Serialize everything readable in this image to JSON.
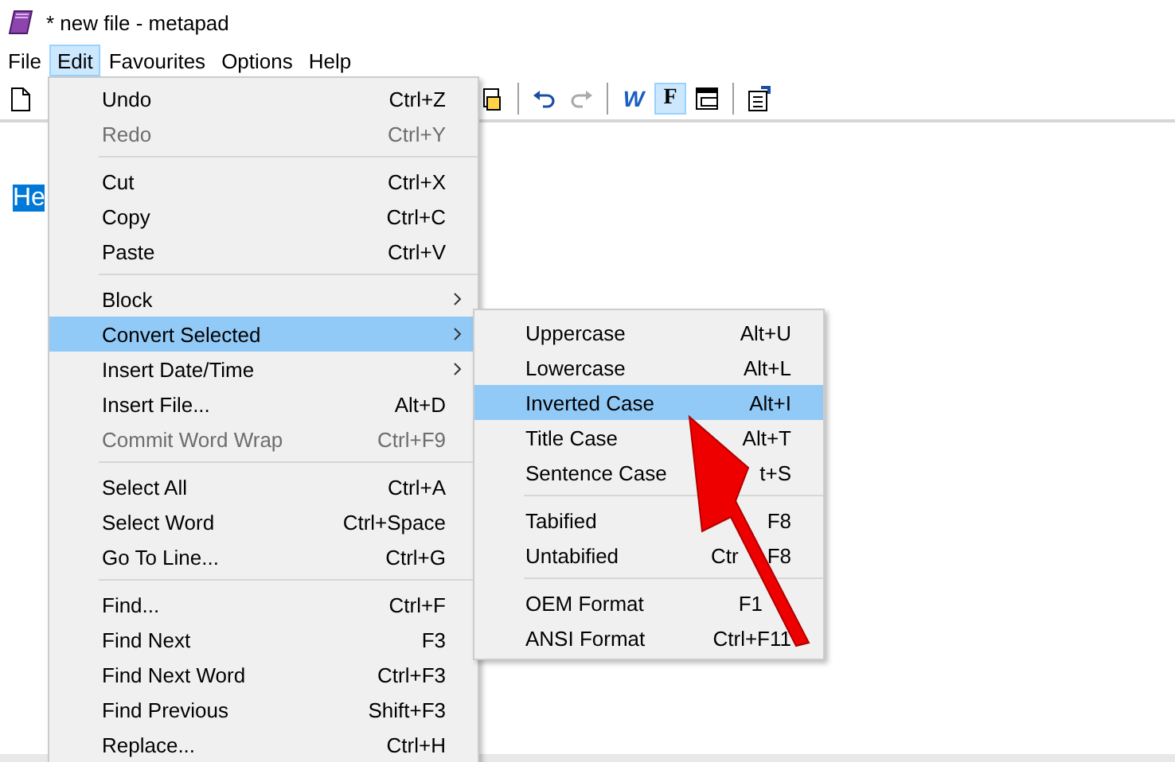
{
  "window": {
    "title": "* new file - metapad"
  },
  "menubar": [
    {
      "label": "File",
      "selected": false
    },
    {
      "label": "Edit",
      "selected": true
    },
    {
      "label": "Favourites",
      "selected": false
    },
    {
      "label": "Options",
      "selected": false
    },
    {
      "label": "Help",
      "selected": false
    }
  ],
  "toolbar": [
    {
      "kind": "new-file"
    },
    {
      "kind": "hidden"
    },
    {
      "kind": "print"
    },
    {
      "kind": "separator"
    },
    {
      "kind": "undo",
      "disabled": false
    },
    {
      "kind": "redo",
      "disabled": true
    },
    {
      "kind": "separator"
    },
    {
      "kind": "letter",
      "label": "W",
      "pressed": false
    },
    {
      "kind": "letter",
      "label": "F",
      "pressed": true
    },
    {
      "kind": "window",
      "pressed": false
    },
    {
      "kind": "separator"
    },
    {
      "kind": "properties"
    }
  ],
  "editor": {
    "selected_text": "He"
  },
  "edit_menu": [
    {
      "kind": "item",
      "label": "Undo",
      "shortcut": "Ctrl+Z",
      "disabled": false,
      "selected": false
    },
    {
      "kind": "item",
      "label": "Redo",
      "shortcut": "Ctrl+Y",
      "disabled": true,
      "selected": false
    },
    {
      "kind": "separator"
    },
    {
      "kind": "item",
      "label": "Cut",
      "shortcut": "Ctrl+X",
      "disabled": false,
      "selected": false
    },
    {
      "kind": "item",
      "label": "Copy",
      "shortcut": "Ctrl+C",
      "disabled": false,
      "selected": false
    },
    {
      "kind": "item",
      "label": "Paste",
      "shortcut": "Ctrl+V",
      "disabled": false,
      "selected": false
    },
    {
      "kind": "separator"
    },
    {
      "kind": "submenu",
      "label": "Block",
      "disabled": false,
      "selected": false
    },
    {
      "kind": "submenu",
      "label": "Convert Selected",
      "disabled": false,
      "selected": true
    },
    {
      "kind": "submenu",
      "label": "Insert Date/Time",
      "disabled": false,
      "selected": false
    },
    {
      "kind": "item",
      "label": "Insert File...",
      "shortcut": "Alt+D",
      "disabled": false,
      "selected": false
    },
    {
      "kind": "item",
      "label": "Commit Word Wrap",
      "shortcut": "Ctrl+F9",
      "disabled": true,
      "selected": false
    },
    {
      "kind": "separator"
    },
    {
      "kind": "item",
      "label": "Select All",
      "shortcut": "Ctrl+A",
      "disabled": false,
      "selected": false
    },
    {
      "kind": "item",
      "label": "Select Word",
      "shortcut": "Ctrl+Space",
      "disabled": false,
      "selected": false
    },
    {
      "kind": "item",
      "label": "Go To Line...",
      "shortcut": "Ctrl+G",
      "disabled": false,
      "selected": false
    },
    {
      "kind": "separator"
    },
    {
      "kind": "item",
      "label": "Find...",
      "shortcut": "Ctrl+F",
      "disabled": false,
      "selected": false
    },
    {
      "kind": "item",
      "label": "Find Next",
      "shortcut": "F3",
      "disabled": false,
      "selected": false
    },
    {
      "kind": "item",
      "label": "Find Next Word",
      "shortcut": "Ctrl+F3",
      "disabled": false,
      "selected": false
    },
    {
      "kind": "item",
      "label": "Find Previous",
      "shortcut": "Shift+F3",
      "disabled": false,
      "selected": false
    },
    {
      "kind": "item",
      "label": "Replace...",
      "shortcut": "Ctrl+H",
      "disabled": false,
      "selected": false
    }
  ],
  "convert_submenu": [
    {
      "kind": "item",
      "label": "Uppercase",
      "shortcut": [
        "Alt+U"
      ],
      "selected": false
    },
    {
      "kind": "item",
      "label": "Lowercase",
      "shortcut": [
        "Alt+L"
      ],
      "selected": false
    },
    {
      "kind": "item",
      "label": "Inverted Case",
      "shortcut": [
        "Alt+I"
      ],
      "selected": true
    },
    {
      "kind": "item",
      "label": "Title Case",
      "shortcut": [
        "Alt+T"
      ],
      "selected": false
    },
    {
      "kind": "item",
      "label": "Sentence Case",
      "shortcut": [
        "t+S"
      ],
      "selected": false
    },
    {
      "kind": "separator"
    },
    {
      "kind": "item",
      "label": "Tabified",
      "shortcut": [
        "F8"
      ],
      "selected": false
    },
    {
      "kind": "item",
      "label": "Untabified",
      "shortcut": [
        "Ctr",
        "F8"
      ],
      "selected": false
    },
    {
      "kind": "separator"
    },
    {
      "kind": "item",
      "label": "OEM Format",
      "shortcut": [
        "F1"
      ],
      "selected": false
    },
    {
      "kind": "item",
      "label": "ANSI Format",
      "shortcut": [
        "Ctrl+F11"
      ],
      "selected": false
    }
  ]
}
